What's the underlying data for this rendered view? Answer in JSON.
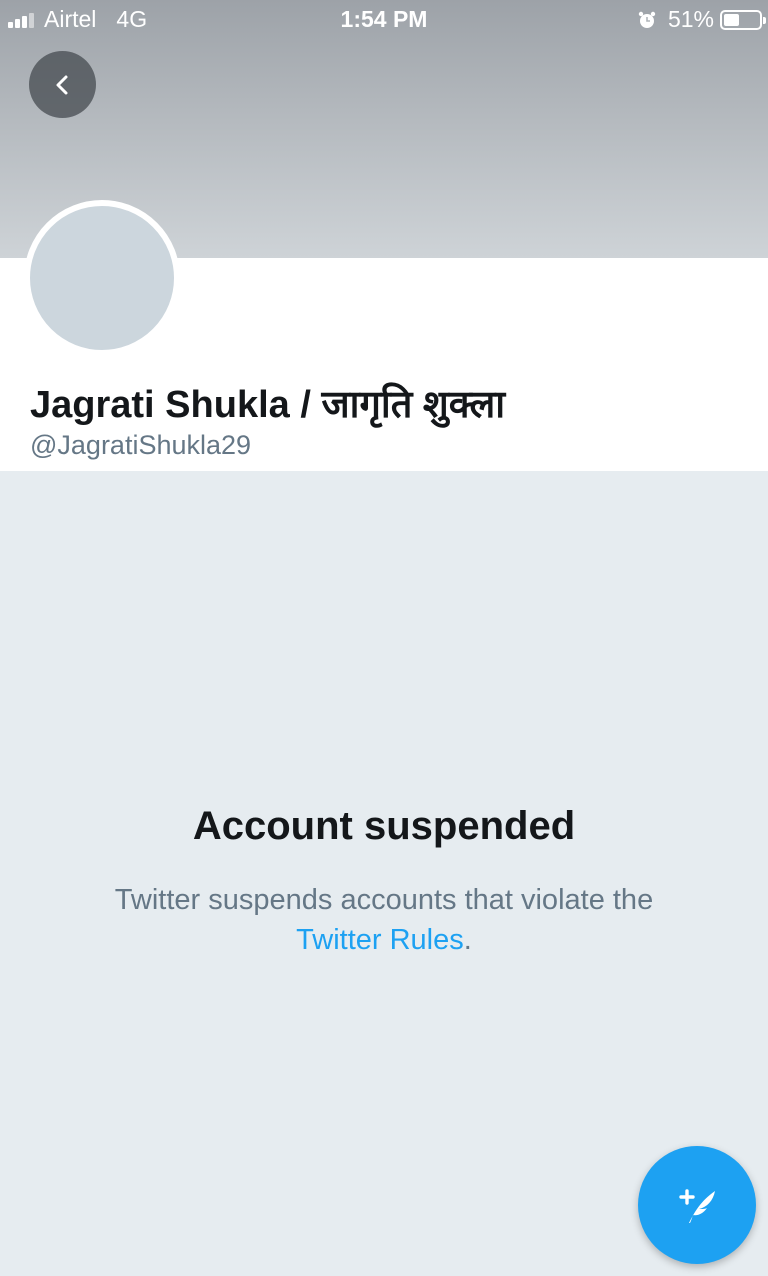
{
  "status_bar": {
    "carrier": "Airtel",
    "network": "4G",
    "time": "1:54 PM",
    "battery": "51%",
    "battery_level": 0.51,
    "icons": [
      "signal-icon",
      "alarm-icon",
      "battery-icon"
    ]
  },
  "header": {
    "back_icon": "chevron-left-icon"
  },
  "profile": {
    "display_name": "Jagrati Shukla / जागृति शुक्ला",
    "handle": "@JagratiShukla29"
  },
  "suspended": {
    "title": "Account suspended",
    "message": "Twitter suspends accounts that violate the",
    "link_text": "Twitter Rules",
    "suffix": "."
  },
  "compose": {
    "icon": "compose-tweet-icon"
  },
  "colors": {
    "accent": "#1da1f2",
    "background": "#e6ecf0",
    "avatar_placeholder": "#ccd6dd",
    "text_primary": "#14171a",
    "text_secondary": "#657786"
  }
}
